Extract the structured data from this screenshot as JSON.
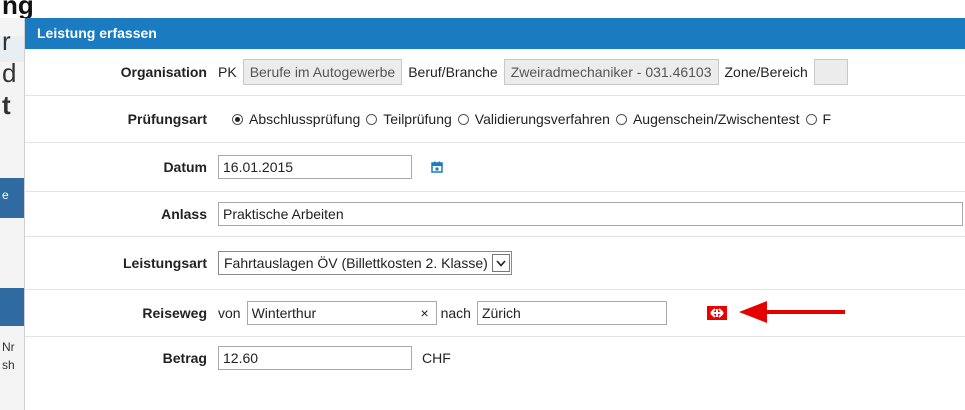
{
  "background": {
    "title_fragment": "ng",
    "side_fragments": [
      "r",
      "d",
      "t",
      "e",
      "Nr",
      "sh"
    ]
  },
  "dialog": {
    "title": "Leistung erfassen",
    "organisation": {
      "label": "Organisation",
      "prefix": "PK",
      "pk_value": "Berufe im Autogewerbe",
      "beruf_label": "Beruf/Branche",
      "beruf_value": "Zweiradmechaniker - 031.46103",
      "zone_label": "Zone/Bereich"
    },
    "pruefungsart": {
      "label": "Prüfungsart",
      "options": [
        {
          "label": "Abschlussprüfung",
          "selected": true
        },
        {
          "label": "Teilprüfung",
          "selected": false
        },
        {
          "label": "Validierungsverfahren",
          "selected": false
        },
        {
          "label": "Augenschein/Zwischentest",
          "selected": false
        },
        {
          "label": "F",
          "selected": false
        }
      ]
    },
    "datum": {
      "label": "Datum",
      "value": "16.01.2015",
      "icon": "calendar-icon"
    },
    "anlass": {
      "label": "Anlass",
      "value": "Praktische Arbeiten"
    },
    "leistungsart": {
      "label": "Leistungsart",
      "selected": "Fahrtauslagen ÖV (Billettkosten 2. Klasse)"
    },
    "reiseweg": {
      "label": "Reiseweg",
      "von_label": "von",
      "von_value": "Winterthur",
      "clear": "×",
      "nach_label": "nach",
      "nach_value": "Zürich",
      "icon": "sbb-logo-icon"
    },
    "betrag": {
      "label": "Betrag",
      "value": "12.60",
      "currency": "CHF"
    }
  },
  "colors": {
    "titlebar": "#1a7bc0",
    "sbb_red": "#eb0000",
    "arrow_red": "#e60000"
  }
}
